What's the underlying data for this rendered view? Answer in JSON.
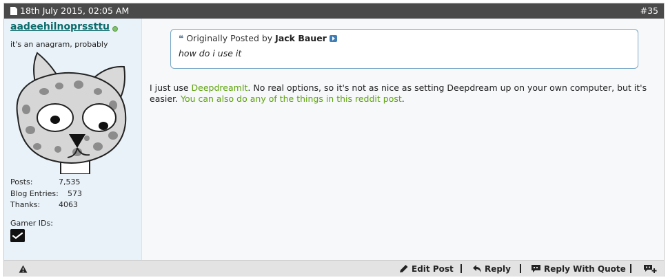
{
  "post": {
    "date": "18th July 2015, 02:05 AM",
    "number": "#35"
  },
  "user": {
    "name": "aadeehilnoprssttu",
    "title": "it's an anagram, probably",
    "avatar_icon": "snow-leopard-avatar",
    "stats": [
      {
        "label": "Posts:",
        "value": "7,535"
      },
      {
        "label": "Blog Entries:",
        "value": "573"
      },
      {
        "label": "Thanks:",
        "value": "4063"
      }
    ],
    "gamer_ids_label": "Gamer IDs:",
    "gamer_icon": "steam-icon"
  },
  "quote": {
    "prefix": "Originally Posted by",
    "author": "Jack Bauer",
    "text": "how do i use it"
  },
  "message": {
    "part1": "I just use ",
    "link1": "DeepdreamIt",
    "part2": ". No real options, so it's not as nice as setting Deepdream up on your own computer, but it's easier. ",
    "link2": "You can also do any of the things in this reddit post",
    "part3": "."
  },
  "footer": {
    "edit_label": "Edit Post",
    "reply_label": "Reply",
    "reply_quote_label": "Reply With Quote"
  },
  "colors": {
    "header_bg": "#4a4a4a",
    "username": "#0c6b6b",
    "link": "#5ea30b",
    "quote_border": "#7aa8c8",
    "user_column_bg": "#e9f2f9"
  }
}
